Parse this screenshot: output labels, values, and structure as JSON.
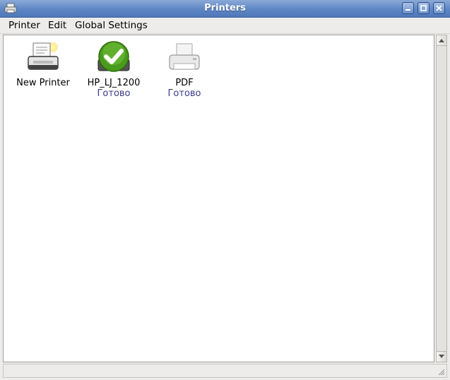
{
  "window": {
    "title": "Printers"
  },
  "menubar": {
    "items": [
      {
        "label": "Printer"
      },
      {
        "label": "Edit"
      },
      {
        "label": "Global Settings"
      }
    ]
  },
  "printers": [
    {
      "name": "New Printer",
      "status": "",
      "icon": "new-printer-icon"
    },
    {
      "name": "HP_LJ_1200",
      "status": "Готово",
      "icon": "default-printer-check-icon"
    },
    {
      "name": "PDF",
      "status": "Готово",
      "icon": "printer-icon"
    }
  ],
  "colors": {
    "titlebar": "#5e86c5",
    "status_text": "#3a3a8c",
    "check_green": "#4a9a1c"
  }
}
